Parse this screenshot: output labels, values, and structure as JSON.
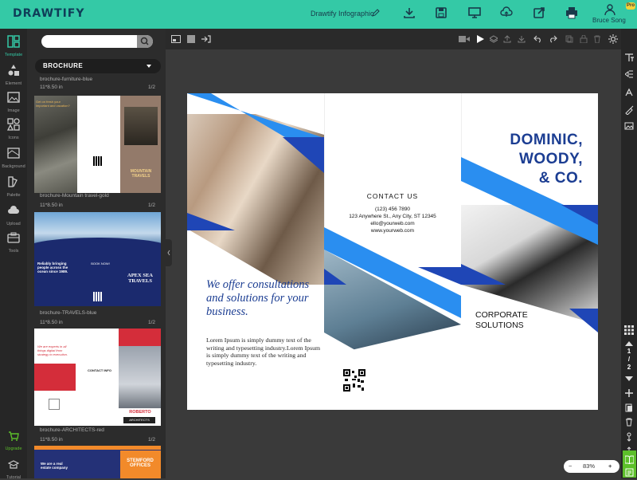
{
  "app": {
    "logo": "DRAWTIFY",
    "badge": "Pro"
  },
  "header": {
    "doc_title": "Drawtify Infographic",
    "user_name": "Bruce Song",
    "icons": [
      "edit-icon",
      "download-icon",
      "save-icon",
      "present-icon",
      "cloud-upload-icon",
      "share-icon",
      "print-icon",
      "user-icon"
    ]
  },
  "left_rail": {
    "items": [
      {
        "label": "Template",
        "icon": "template-icon",
        "active": true
      },
      {
        "label": "Element",
        "icon": "element-icon"
      },
      {
        "label": "Image",
        "icon": "image-icon"
      },
      {
        "label": "Icons",
        "icon": "icons-icon"
      },
      {
        "label": "Background",
        "icon": "background-icon"
      },
      {
        "label": "Palette",
        "icon": "palette-icon"
      },
      {
        "label": "Upload",
        "icon": "upload-icon"
      },
      {
        "label": "Tools",
        "icon": "tools-icon"
      }
    ],
    "upgrade_label": "Upgrade",
    "tutorial_label": "Tutorial"
  },
  "panel": {
    "search_placeholder": "",
    "category": "BROCHURE",
    "templates": [
      {
        "name": "brochure-furniture-blue",
        "size": "11*8.50 in",
        "pages": "1/2"
      },
      {
        "name": "brochure-Mountain travel-gold",
        "size": "11*8.50 in",
        "pages": "1/2"
      },
      {
        "name": "brochure-TRAVELS-blue",
        "size": "11*8.50 in",
        "pages": "1/2"
      },
      {
        "name": "brochure-ARCHITECTS-red",
        "size": "11*8.50 in",
        "pages": "1/2"
      }
    ],
    "thumbs": {
      "mountain_title": "MOUNTAIN TRAVELS",
      "mountain_note": "Get on fresh your important and vacation?",
      "apex_title": "APEX SEA TRAVELS",
      "apex_note": "Reliably bringing people across the ocean since 1989.",
      "apex_booking": "BOOK NOW!",
      "arch_note": "We are experts in all things digital from strategy to execution.",
      "arch_contact": "CONTACT INFO",
      "arch_title": "ROBERTO",
      "arch_sub": "ARCHITECTS",
      "stamford_title": "STEMFORD OFFICES",
      "stamford_note": "We are a real estate company"
    }
  },
  "document": {
    "headline": "We offer consultations and solutions for your business.",
    "body": "Lorem Ipsum is simply dummy text of the writing and typesetting industry.Lorem Ipsum is simply dummy text of the writing and typesetting industry.",
    "contact_title": "CONTACT US",
    "phone": "(123) 456 7890",
    "address": "123 Anywhere St., Any City, ST 12345",
    "email": "ello@yourweb.com",
    "website": "www.yourweb.com",
    "company_line1": "DOMINIC,",
    "company_line2": "WOODY,",
    "company_line3": "& CO.",
    "corp_line1": "CORPORATE",
    "corp_line2": "SOLUTIONS"
  },
  "pager": {
    "current": "1",
    "separator": "/",
    "total": "2"
  },
  "zoom": {
    "minus": "−",
    "value": "83%",
    "plus": "+"
  },
  "colors": {
    "accent": "#34c9a6",
    "brand_blue": "#1b3d92",
    "light_blue": "#2a8ef0",
    "upgrade_green": "#5cbf2a"
  }
}
